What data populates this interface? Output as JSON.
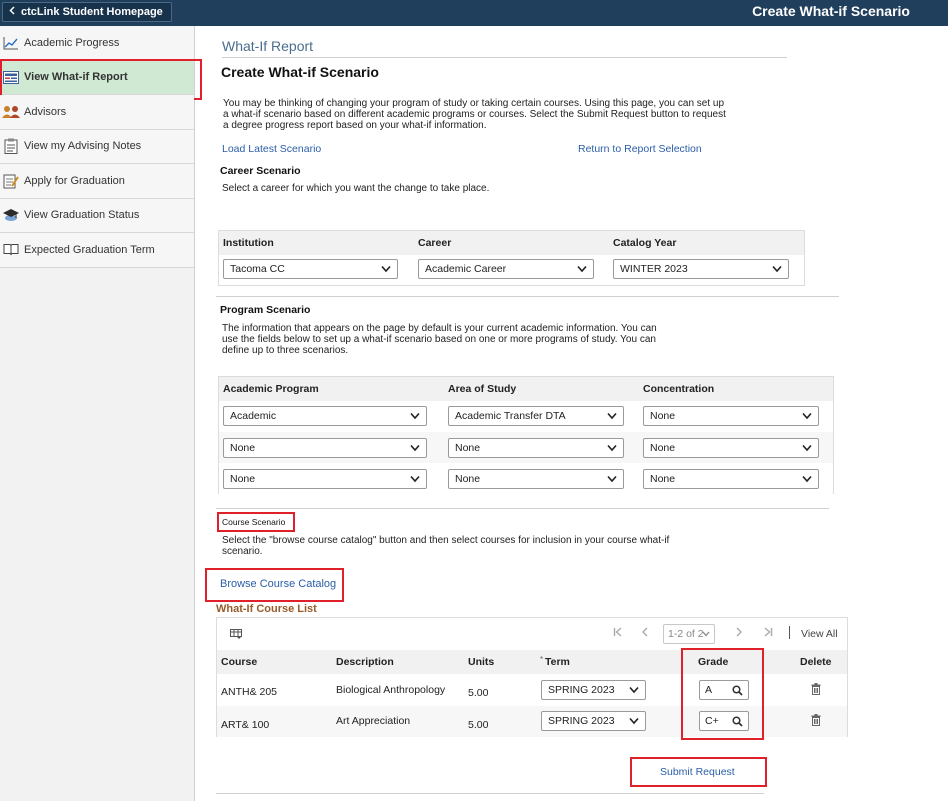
{
  "header": {
    "home_label": "ctcLink Student Homepage",
    "page_title": "Create What-if Scenario"
  },
  "sidebar": {
    "items": [
      {
        "label": "Academic Progress",
        "icon": "chart-line-icon"
      },
      {
        "label": "View What-if Report",
        "icon": "report-icon"
      },
      {
        "label": "Advisors",
        "icon": "people-icon"
      },
      {
        "label": "View my Advising Notes",
        "icon": "notes-icon"
      },
      {
        "label": "Apply for Graduation",
        "icon": "apply-icon"
      },
      {
        "label": "View Graduation Status",
        "icon": "graduation-cap-icon"
      },
      {
        "label": "Expected Graduation Term",
        "icon": "book-icon"
      }
    ]
  },
  "main": {
    "report_title": "What-If Report",
    "scenario_title": "Create What-if Scenario",
    "intro_text": "You may be thinking of changing your program of study or taking certain courses. Using this page, you can set up a what-if scenario based on different academic programs or courses. Select the Submit Request button to request a degree progress report based on your what-if information.",
    "load_latest": "Load Latest Scenario",
    "return_link": "Return to Report Selection",
    "career": {
      "title": "Career Scenario",
      "text": "Select a career for which you want the change to take place.",
      "headers": [
        "Institution",
        "Career",
        "Catalog Year"
      ],
      "values": [
        "Tacoma CC",
        "Academic Career",
        "WINTER 2023"
      ]
    },
    "program": {
      "title": "Program Scenario",
      "text": "The information that appears on the page by default is your current academic information. You can use the fields below to set up a what-if scenario based on one or more programs of study. You can define up to three scenarios.",
      "headers": [
        "Academic Program",
        "Area of Study",
        "Concentration"
      ],
      "rows": [
        [
          "Academic",
          "Academic Transfer DTA",
          "None"
        ],
        [
          "None",
          "None",
          "None"
        ],
        [
          "None",
          "None",
          "None"
        ]
      ]
    },
    "course": {
      "title": "Course Scenario",
      "text": "Select the \"browse course catalog\" button and then select courses for inclusion in your course what-if scenario.",
      "browse_label": "Browse Course Catalog",
      "list_title": "What-If Course List",
      "pager_value": "1-2 of 2",
      "view_all": "View All",
      "headers": {
        "course": "Course",
        "description": "Description",
        "units": "Units",
        "term_marker": "*",
        "term": "Term",
        "grade": "Grade",
        "delete": "Delete"
      },
      "rows": [
        {
          "course": "ANTH&  205",
          "description": "Biological Anthropology",
          "units": "5.00",
          "term": "SPRING 2023",
          "grade": "A"
        },
        {
          "course": "ART&  100",
          "description": "Art Appreciation",
          "units": "5.00",
          "term": "SPRING 2023",
          "grade": "C+"
        }
      ]
    },
    "submit_label": "Submit Request"
  },
  "colors": {
    "header_bg": "#1f3f5d",
    "active_nav": "#cfe9d3",
    "link": "#2b5ea8",
    "highlight": "#e0202a",
    "list_title": "#9a5b2a"
  }
}
